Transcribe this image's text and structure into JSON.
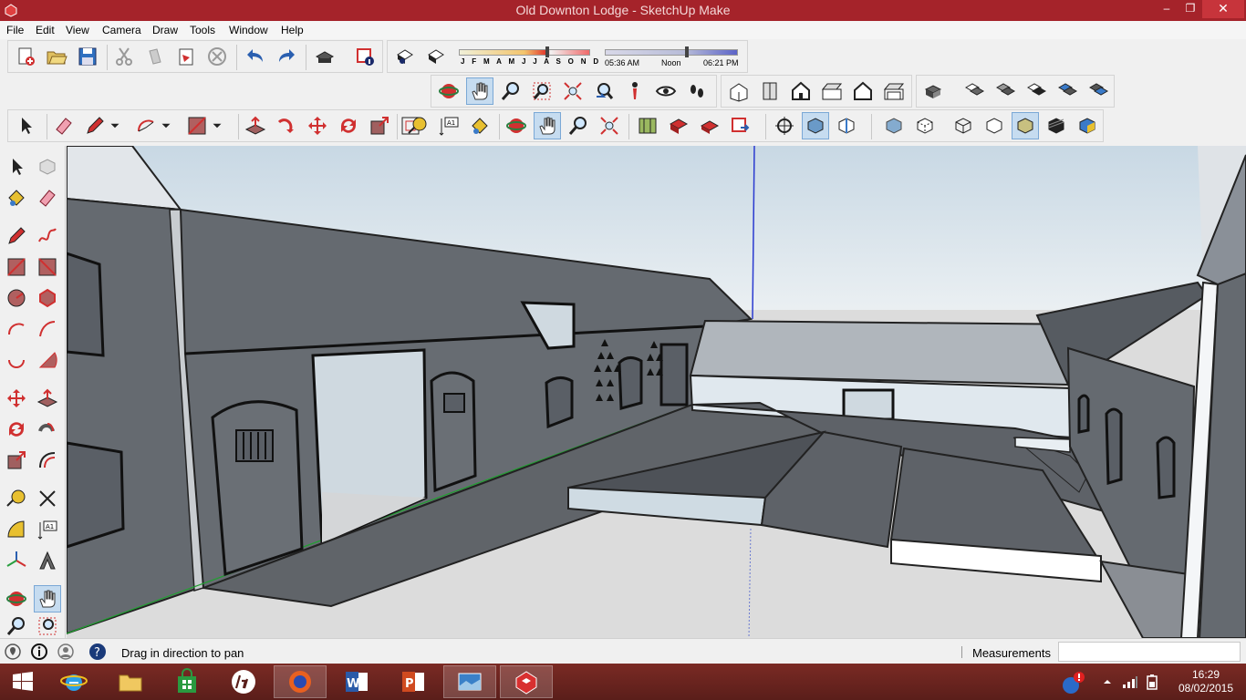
{
  "window": {
    "title": "Old Downton Lodge - SketchUp Make",
    "min_label": "–",
    "max_label": "❐",
    "close_label": "✕"
  },
  "menu": {
    "items": [
      "File",
      "Edit",
      "View",
      "Camera",
      "Draw",
      "Tools",
      "Window",
      "Help"
    ]
  },
  "shadows": {
    "months": "J F M A M J J A S O N D",
    "time_start": "05:36 AM",
    "time_mid": "Noon",
    "time_end": "06:21 PM"
  },
  "status": {
    "message": "Drag in direction to pan",
    "measurements_label": "Measurements",
    "measurements_value": ""
  },
  "taskbar": {
    "time": "16:29",
    "date": "08/02/2015"
  },
  "colors": {
    "titlebar": "#a5232a",
    "taskbar": "#6a2420",
    "active_tool": "#c6dcf0"
  }
}
